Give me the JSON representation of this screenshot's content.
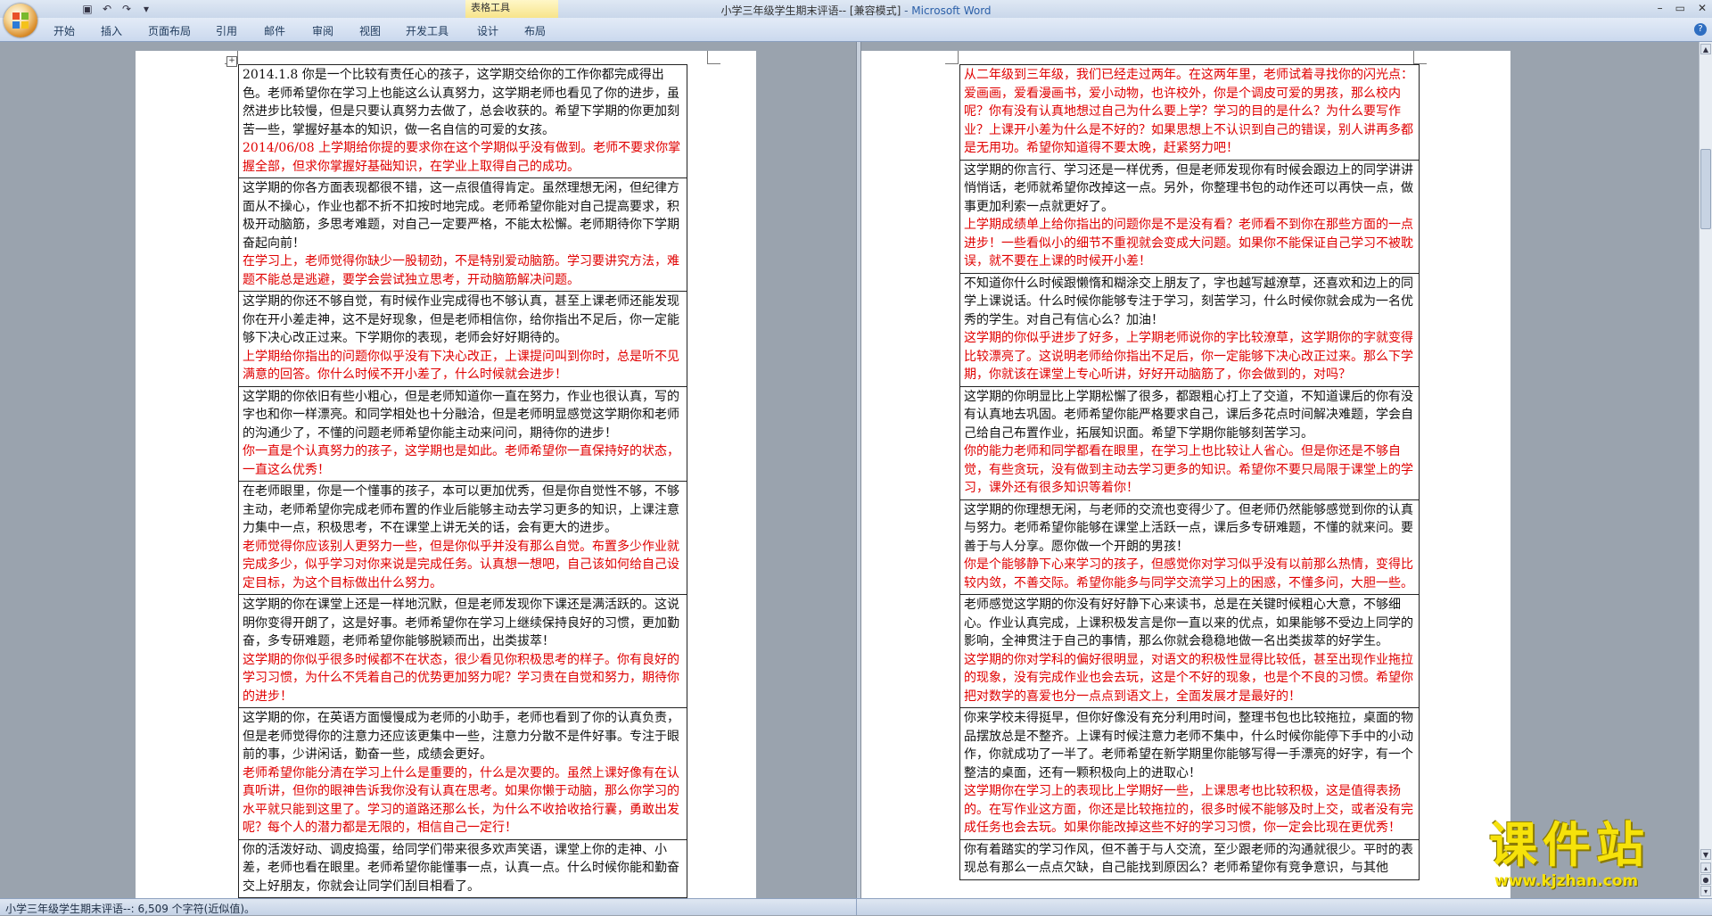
{
  "window": {
    "title_doc": "小学三年级学生期末评语-- [兼容模式]",
    "title_sep": " - ",
    "title_app": "Microsoft Word",
    "context_tab_group": "表格工具",
    "minimize": "–",
    "restore": "▭",
    "close": "✕"
  },
  "tabs": [
    "开始",
    "插入",
    "页面布局",
    "引用",
    "邮件",
    "审阅",
    "视图",
    "开发工具",
    "设计",
    "布局"
  ],
  "left_rows": [
    {
      "black": "2014.1.8 你是一个比较有责任心的孩子，这学期交给你的工作你都完成得出色。老师希望你在学习上也能这么认真努力，这学期老师也看见了你的进步，虽然进步比较慢，但是只要认真努力去做了，总会收获的。希望下学期的你更加刻苦一些，掌握好基本的知识，做一名自信的可爱的女孩。",
      "red": "2014/06/08 上学期给你提的要求你在这个学期似乎没有做到。老师不要求你掌握全部，但求你掌握好基础知识，在学业上取得自己的成功。"
    },
    {
      "black": "这学期的你各方面表现都很不错，这一点很值得肯定。虽然理想无闲，但纪律方面从不操心，作业也都不折不扣按时地完成。老师希望你能对自己提高要求，积极开动脑筋，多思考难题，对自己一定要严格，不能太松懈。老师期待你下学期奋起向前！",
      "red": "在学习上，老师觉得你缺少一股韧劲，不是特别爱动脑筋。学习要讲究方法，难题不能总是逃避，要学会尝试独立思考，开动脑筋解决问题。"
    },
    {
      "black": "这学期的你还不够自觉，有时候作业完成得也不够认真，甚至上课老师还能发现你在开小差走神，这不是好现象，但是老师相信你，给你指出不足后，你一定能够下决心改正过来。下学期你的表现，老师会好好期待的。",
      "red": "上学期给你指出的问题你似乎没有下决心改正，上课提问叫到你时，总是听不见满意的回答。你什么时候不开小差了，什么时候就会进步！"
    },
    {
      "black": "这学期的你依旧有些小粗心，但是老师知道你一直在努力，作业也很认真，写的字也和你一样漂亮。和同学相处也十分融洽，但是老师明显感觉这学期你和老师的沟通少了，不懂的问题老师希望你能主动来问问，期待你的进步！",
      "red": "你一直是个认真努力的孩子，这学期也是如此。老师希望你一直保持好的状态，一直这么优秀！"
    },
    {
      "black": "在老师眼里，你是一个懂事的孩子，本可以更加优秀，但是你自觉性不够，不够主动，老师希望你完成老师布置的作业后能够主动去学习更多的知识，上课注意力集中一点，积极思考，不在课堂上讲无关的话，会有更大的进步。",
      "red": "老师觉得你应该别人更努力一些，但是你似乎并没有那么自觉。布置多少作业就完成多少，似乎学习对你来说是完成任务。认真想一想吧，自己该如何给自己设定目标，为这个目标做出什么努力。"
    },
    {
      "black": "这学期的你在课堂上还是一样地沉默，但是老师发现你下课还是满活跃的。这说明你变得开朗了，这是好事。老师希望你在学习上继续保持良好的习惯，更加勤奋，多专研难题，老师希望你能够脱颖而出，出类拔萃！",
      "red": "这学期的你似乎很多时候都不在状态，很少看见你积极思考的样子。你有良好的学习习惯，为什么不凭着自己的优势更加努力呢？学习贵在自觉和努力，期待你的进步！"
    },
    {
      "black": "这学期的你，在英语方面慢慢成为老师的小助手，老师也看到了你的认真负责，但是老师觉得你的注意力还应该更集中一些，注意力分散不是件好事。专注于眼前的事，少讲闲话，勤奋一些，成绩会更好。",
      "red": "老师希望你能分清在学习上什么是重要的，什么是次要的。虽然上课好像有在认真听讲，但你的眼神告诉我你没有认真在思考。如果你懒于动脑，那么你学习的水平就只能到这里了。学习的道路还那么长，为什么不收拾收拾行囊，勇敢出发呢？每个人的潜力都是无限的，相信自己一定行！"
    },
    {
      "black": "你的活泼好动、调皮捣蛋，给同学们带来很多欢声笑语，课堂上你的走神、小差，老师也看在眼里。老师希望你能懂事一点，认真一点。什么时候你能和勤奋交上好朋友，你就会让同学们刮目相看了。",
      "red": ""
    }
  ],
  "right_rows": [
    {
      "black": "",
      "red": "从二年级到三年级，我们已经走过两年。在这两年里，老师试着寻找你的闪光点：爱画画，爱看漫画书，爱小动物，也许校外，你是个调皮可爱的男孩，那么校内呢？你有没有认真地想过自己为什么要上学？学习的目的是什么？为什么要写作业？上课开小差为什么是不好的？如果思想上不认识到自己的错误，别人讲再多都是无用功。希望你知道得不要太晚，赶紧努力吧！"
    },
    {
      "black": "这学期的你言行、学习还是一样优秀，但是老师发现你有时候会跟边上的同学讲讲悄悄话，老师就希望你改掉这一点。另外，你整理书包的动作还可以再快一点，做事更加利索一点就更好了。",
      "red": "上学期成绩单上给你指出的问题你是不是没有看？老师看不到你在那些方面的一点进步！一些看似小的细节不重视就会变成大问题。如果你不能保证自己学习不被耽误，就不要在上课的时候开小差！"
    },
    {
      "black": "不知道你什么时候跟懒惰和糊涂交上朋友了，字也越写越潦草，还喜欢和边上的同学上课说话。什么时候你能够专注于学习，刻苦学习，什么时候你就会成为一名优秀的学生。对自己有信心么？加油！",
      "red": "这学期的你似乎进步了好多，上学期老师说你的字比较潦草，这学期你的字就变得比较漂亮了。这说明老师给你指出不足后，你一定能够下决心改正过来。那么下学期，你就该在课堂上专心听讲，好好开动脑筋了，你会做到的，对吗？"
    },
    {
      "black": "这学期的你明显比上学期松懈了很多，都跟粗心打上了交道，不知道课后的你有没有认真地去巩固。老师希望你能严格要求自己，课后多花点时间解决难题，学会自己给自己布置作业，拓展知识面。希望下学期你能够刻苦学习。",
      "red": "你的能力老师和同学都看在眼里，在学习上也比较让人省心。但是你还是不够自觉，有些贪玩，没有做到主动去学习更多的知识。希望你不要只局限于课堂上的学习，课外还有很多知识等着你！"
    },
    {
      "black": "这学期的你理想无闲，与老师的交流也变得少了。但老师仍然能够感觉到你的认真与努力。老师希望你能够在课堂上活跃一点，课后多专研难题，不懂的就来问。要善于与人分享。愿你做一个开朗的男孩！",
      "red": "你是个能够静下心来学习的孩子，但感觉你对学习似乎没有以前那么热情，变得比较内敛，不善交际。希望你能多与同学交流学习上的困惑，不懂多问，大胆一些。"
    },
    {
      "black": "老师感觉这学期的你没有好好静下心来读书，总是在关键时候粗心大意，不够细心。作业认真完成，上课积极发言是你一直以来的优点，如果能够不受边上同学的影响，全神贯注于自己的事情，那么你就会稳稳地做一名出类拔萃的好学生。",
      "red": "这学期的你对学科的偏好很明显，对语文的积极性显得比较低，甚至出现作业拖拉的现象，没有完成作业也会去玩，这是个不好的现象，也是个不良的习惯。希望你把对数学的喜爱也分一点点到语文上，全面发展才是最好的！"
    },
    {
      "black": "你来学校未得挺早，但你好像没有充分利用时间，整理书包也比较拖拉，桌面的物品摆放总是不整齐。上课有时候注意力老师不集中，什么时候你能停下手中的小动作，你就成功了一半了。老师希望在新学期里你能够写得一手漂亮的好字，有一个整洁的桌面，还有一颗积极向上的进取心！",
      "red": "这学期你在学习上的表现比上学期好一些，上课思考也比较积极，这是值得表扬的。在写作业这方面，你还是比较拖拉的，很多时候不能够及时上交，或者没有完成任务也会去玩。如果你能改掉这些不好的学习习惯，你一定会比现在更优秀！"
    },
    {
      "black": "你有着踏实的学习作风，但不善于与人交流，至少跟老师的沟通就很少。平时的表现总有那么一点点欠缺，自己能找到原因么？老师希望你有竞争意识，与其他",
      "red": ""
    }
  ],
  "status": {
    "left_text": "小学三年级学生期末评语--: 6,509 个字符(近似值)。"
  },
  "watermark": {
    "main": "课件站",
    "url": "www.kjzhan.com"
  },
  "colors": {
    "comment_red": "#e00000",
    "ribbon_blue": "#cbd9ee",
    "watermark_yellow": "#f6e20a"
  }
}
